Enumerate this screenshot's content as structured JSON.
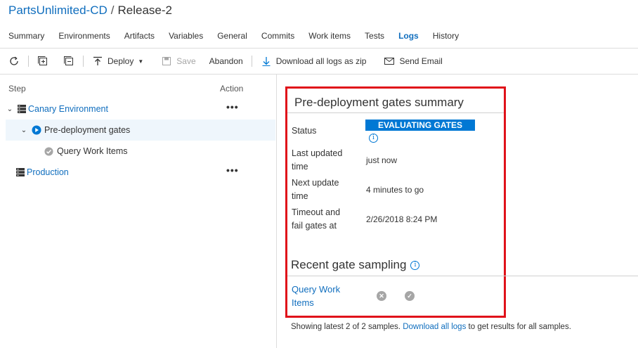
{
  "header": {
    "project": "PartsUnlimited-CD",
    "separator": "/",
    "release": "Release-2"
  },
  "tabs": [
    {
      "label": "Summary"
    },
    {
      "label": "Environments"
    },
    {
      "label": "Artifacts"
    },
    {
      "label": "Variables"
    },
    {
      "label": "General"
    },
    {
      "label": "Commits"
    },
    {
      "label": "Work items"
    },
    {
      "label": "Tests"
    },
    {
      "label": "Logs",
      "active": true
    },
    {
      "label": "History"
    }
  ],
  "toolbar": {
    "deploy_label": "Deploy",
    "save_label": "Save",
    "abandon_label": "Abandon",
    "download_label": "Download all logs as zip",
    "email_label": "Send Email"
  },
  "tree": {
    "step_header": "Step",
    "action_header": "Action",
    "canary_label": "Canary Environment",
    "gates_label": "Pre-deployment gates",
    "query_label": "Query Work Items",
    "production_label": "Production",
    "actions_symbol": "•••"
  },
  "summary": {
    "title": "Pre-deployment gates summary",
    "status_label": "Status",
    "status_value": "EVALUATING GATES",
    "last_updated_label_1": "Last updated",
    "last_updated_label_2": "time",
    "last_updated_value": "just now",
    "next_update_label_1": "Next update",
    "next_update_label_2": "time",
    "next_update_value": "4 minutes to go",
    "timeout_label_1": "Timeout and",
    "timeout_label_2": "fail gates at",
    "timeout_value": "2/26/2018 8:24 PM"
  },
  "sampling": {
    "title": "Recent gate sampling",
    "gate_name_1": "Query Work",
    "gate_name_2": "Items",
    "note_prefix": "Showing latest 2 of 2 samples.",
    "note_link": "Download all logs",
    "note_suffix": "to get results for all samples."
  },
  "colors": {
    "accent": "#0078d4",
    "link": "#106ebe",
    "highlight_border": "#e0121a",
    "selected_row": "#eff6fc"
  },
  "icons": {
    "refresh": "refresh-icon",
    "expand_all": "expand-all-icon",
    "collapse_all": "collapse-all-icon",
    "deploy": "deploy-icon",
    "save": "save-icon",
    "download": "download-icon",
    "email": "email-icon",
    "environment": "server-icon",
    "running": "play-circle-icon",
    "succeeded": "check-circle-icon",
    "failed": "x-circle-icon",
    "info": "info-icon"
  }
}
